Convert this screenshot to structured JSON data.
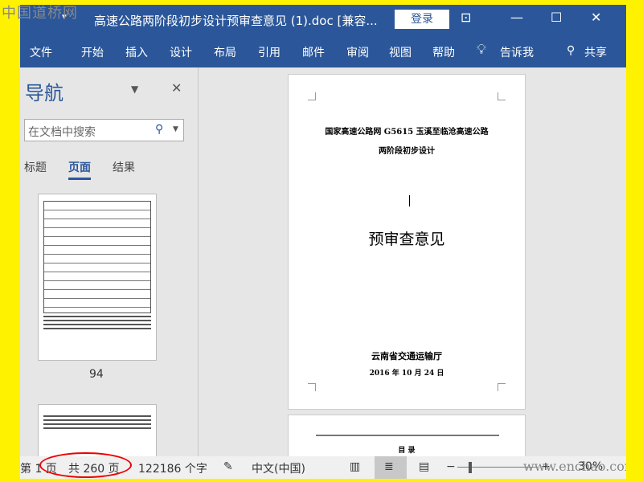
{
  "watermark": "中国道桥网",
  "watermark_bottom": "www.enchao.com",
  "titlebar": {
    "title": "高速公路两阶段初步设计预审查意见 (1).doc [兼容...",
    "login": "登录"
  },
  "ribbon": {
    "tabs": [
      "文件",
      "开始",
      "插入",
      "设计",
      "布局",
      "引用",
      "邮件",
      "审阅",
      "视图",
      "帮助"
    ],
    "tell_me": "告诉我",
    "share": "共享"
  },
  "nav": {
    "heading": "导航",
    "search_placeholder": "在文档中搜索",
    "tabs": [
      "标题",
      "页面",
      "结果"
    ],
    "thumb_page": "94"
  },
  "document": {
    "line1": "国家高速公路网 G5615 玉溪至临沧高速公路",
    "line2": "两阶段初步设计",
    "main_title": "预审查意见",
    "org": "云南省交通运输厅",
    "date": "2016 年 10 月 24 日",
    "page2_heading": "目  录"
  },
  "status": {
    "page": "第 1 页",
    "total": "共 260 页",
    "words": "122186 个字",
    "language": "中文(中国)",
    "zoom": "30%"
  }
}
